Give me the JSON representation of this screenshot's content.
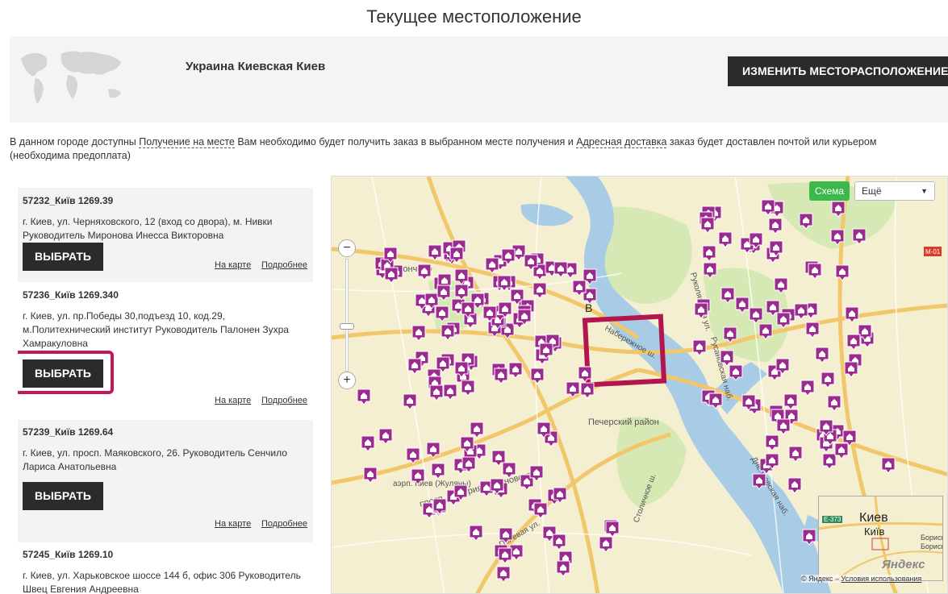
{
  "page_title": "Текущее местоположение",
  "location": {
    "name": "Украина Киевская Киев",
    "change_button": "ИЗМЕНИТЬ МЕСТОРАСПОЛОЖЕНИЕ"
  },
  "info": {
    "part1": "В данном городе доступны ",
    "link1": "Получение на месте",
    "part2": " Вам необходимо будет получить заказ в выбранном месте получения и ",
    "link2": "Адресная доставка",
    "part3": " заказ будет доставлен почтой или курьером (необходима предоплата)"
  },
  "pickup_points": [
    {
      "title": "57232_Київ 1269.39",
      "address": "г. Киев, ул. Черняховского, 12 (вход со двора), м. Нивки Руководитель Миронова Инесса Викторовна",
      "select": "ВЫБРАТЬ",
      "on_map": "На карте",
      "details": "Подробнее"
    },
    {
      "title": "57236_Київ 1269.340",
      "address": "г. Киев, ул. пр.Победы 30,подъезд 10, код.29, м.Политехнический институт Руководитель Палонен Зухра Хамракуловна",
      "select": "ВЫБРАТЬ",
      "on_map": "На карте",
      "details": "Подробнее"
    },
    {
      "title": "57239_Київ 1269.64",
      "address": "г. Киев, ул. просп. Маяковского, 26. Руководитель Сенчило Лариса Анатольевна",
      "select": "ВЫБРАТЬ",
      "on_map": "На карте",
      "details": "Подробнее"
    },
    {
      "title": "57245_Київ 1269.10",
      "address": "г. Киев, ул. Харьковское шоссе 144 б, офис 306 Руководитель Швец Евгения Андреевна"
    }
  ],
  "map": {
    "scheme_button": "Схема",
    "more_select": "Ещё",
    "zoom_in": "+",
    "zoom_out": "−",
    "labels": {
      "district1": "райончено",
      "district2": "Печерский район",
      "street1": "просп. Валерия Лобановского",
      "street2": "Набережное ш.",
      "street3": "Столичное ш.",
      "street4": "Днепровская наб.",
      "street5": "Русановская наб.",
      "street6": "Руколянская ул.",
      "street7": "Полевая ул.",
      "airport": "аэрп. Киев (Жуляны)",
      "route": "М-01",
      "letter": "В"
    },
    "minimap": {
      "city": "Киев",
      "city_ua": "Київ",
      "route": "E-373",
      "side": "Борисп Борисп"
    },
    "yandex": "Яндекс",
    "copyright": "© Яндекс – ",
    "terms": "Условия использования"
  },
  "colors": {
    "marker": "#9b2b8f",
    "highlight": "#c2185b",
    "button_dark": "#2b2b2b",
    "scheme_green": "#3db84a"
  }
}
